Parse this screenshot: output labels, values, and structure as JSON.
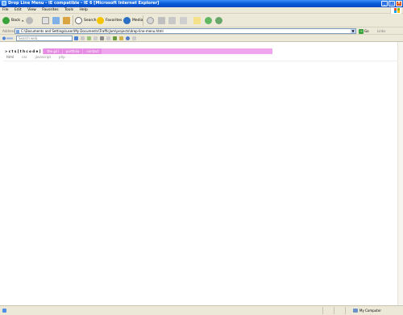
{
  "window": {
    "title": "Drop Line Menu - IE compatible - IE 6 [Microsoft Internet Explorer]"
  },
  "menu": [
    "File",
    "Edit",
    "View",
    "Favorites",
    "Tools",
    "Help"
  ],
  "toolbar": {
    "back_label": "Back",
    "search_label": "Search",
    "favorites_label": "Favorites",
    "media_label": "Media"
  },
  "address": {
    "label": "Address",
    "value": "C:\\Documents and Settings\\user\\My Documents\\TrafficJam\\projects\\drop-line-menu.html",
    "go_label": "Go",
    "links_label": "Links"
  },
  "searchbar": {
    "placeholder": "Search web"
  },
  "page": {
    "brand": "> c t s [ t h c o d e ]",
    "tabs": [
      "the girl",
      "portfolio",
      "contact"
    ],
    "subnav": [
      "html",
      "css",
      "javascript",
      "php"
    ]
  },
  "status": {
    "zone": "My Computer"
  },
  "colors": {
    "nav_bar": "#f0a6ee",
    "nav_tab": "#e58de2",
    "titlebar": "#0a5bd8"
  }
}
